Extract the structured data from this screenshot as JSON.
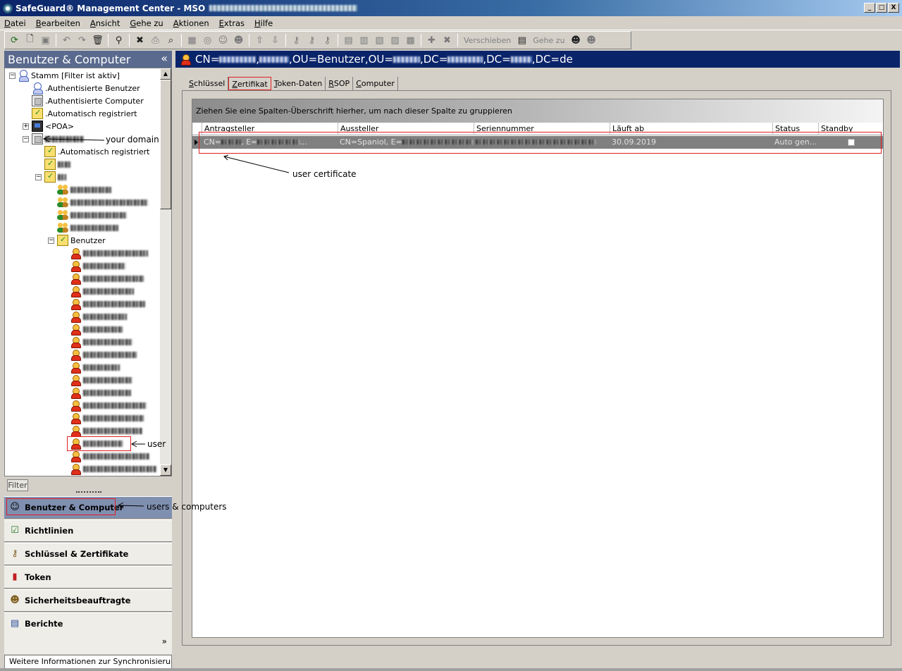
{
  "window": {
    "title": "SafeGuard® Management Center - MSO",
    "minimize": "_",
    "maximize": "□",
    "close": "X"
  },
  "menu": [
    "Datei",
    "Bearbeiten",
    "Ansicht",
    "Gehe zu",
    "Aktionen",
    "Extras",
    "Hilfe"
  ],
  "toolbar": {
    "move_label": "Verschieben",
    "goto_label": "Gehe zu"
  },
  "left": {
    "header": "Benutzer & Computer",
    "collapse_glyph": "«",
    "tree": {
      "root": "Stamm [Filter ist aktiv]",
      "auth_users": ".Authentisierte Benutzer",
      "auth_computers": ".Authentisierte Computer",
      "auto_registered": ".Automatisch registriert",
      "poa": "<POA>",
      "domain_auto_registered": ".Automatisch registriert",
      "users_container": "Benutzer"
    },
    "filter_label": "Filter",
    "nav": [
      {
        "label": "Benutzer & Computer",
        "icon": "users-computers-icon"
      },
      {
        "label": "Richtlinien",
        "icon": "policies-icon"
      },
      {
        "label": "Schlüssel & Zertifikate",
        "icon": "keys-icon"
      },
      {
        "label": "Token",
        "icon": "token-icon"
      },
      {
        "label": "Sicherheitsbeauftragte",
        "icon": "security-officer-icon"
      },
      {
        "label": "Berichte",
        "icon": "reports-icon"
      }
    ],
    "more_glyph": "»",
    "status": "Weitere Informationen zur Synchronisierung..."
  },
  "right": {
    "header": {
      "prefix": "CN=",
      "sep1": ",",
      "mid1": ",OU=Benutzer,OU=",
      "mid2": ",DC=",
      "mid3": ",DC=",
      "suffix": ",DC=de"
    },
    "tabs": [
      "Schlüssel",
      "Zertifikat",
      "Token-Daten",
      "RSOP",
      "Computer"
    ],
    "selected_tab": "Zertifikat",
    "group_hint": "Ziehen Sie eine Spalten-Überschrift hierher, um nach dieser Spalte zu gruppieren",
    "columns": [
      "Antragsteller",
      "Aussteller",
      "Seriennummer",
      "Läuft ab",
      "Status",
      "Standby"
    ],
    "rows": [
      {
        "subject_prefix": "CN=",
        "subject_mid": ", E=",
        "subject_tail": "...",
        "issuer_prefix": "CN=Spaniol, E=",
        "expires": "30.09.2019",
        "status": "Auto gen..."
      }
    ]
  },
  "annotations": {
    "your_domain": "your domain",
    "user_certificate": "user certificate",
    "user": "user",
    "users_computers": "users & computers"
  }
}
